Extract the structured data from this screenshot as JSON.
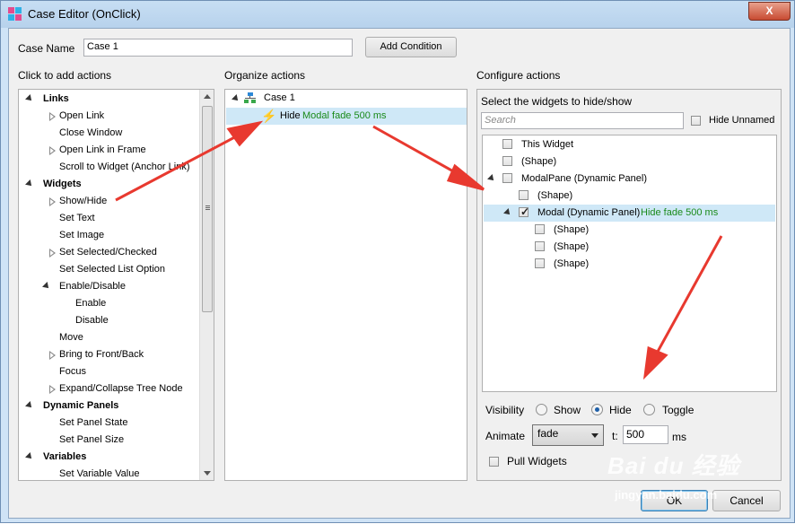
{
  "window": {
    "title": "Case Editor (OnClick)",
    "close_label": "X"
  },
  "case_name": {
    "label": "Case Name",
    "value": "Case 1",
    "add_condition_label": "Add Condition"
  },
  "left": {
    "header": "Click to add actions",
    "items": [
      {
        "label": "Links",
        "kind": "group"
      },
      {
        "label": "Open Link",
        "kind": "item-expand"
      },
      {
        "label": "Close Window",
        "kind": "item"
      },
      {
        "label": "Open Link in Frame",
        "kind": "item-expand"
      },
      {
        "label": "Scroll to Widget (Anchor Link)",
        "kind": "item"
      },
      {
        "label": "Widgets",
        "kind": "group"
      },
      {
        "label": "Show/Hide",
        "kind": "item-expand"
      },
      {
        "label": "Set Text",
        "kind": "item"
      },
      {
        "label": "Set Image",
        "kind": "item"
      },
      {
        "label": "Set Selected/Checked",
        "kind": "item-expand"
      },
      {
        "label": "Set Selected List Option",
        "kind": "item"
      },
      {
        "label": "Enable/Disable",
        "kind": "item-open"
      },
      {
        "label": "Enable",
        "kind": "sub"
      },
      {
        "label": "Disable",
        "kind": "sub"
      },
      {
        "label": "Move",
        "kind": "item"
      },
      {
        "label": "Bring to Front/Back",
        "kind": "item-expand"
      },
      {
        "label": "Focus",
        "kind": "item"
      },
      {
        "label": "Expand/Collapse Tree Node",
        "kind": "item-expand"
      },
      {
        "label": "Dynamic Panels",
        "kind": "group"
      },
      {
        "label": "Set Panel State",
        "kind": "item"
      },
      {
        "label": "Set Panel Size",
        "kind": "item"
      },
      {
        "label": "Variables",
        "kind": "group"
      },
      {
        "label": "Set Variable Value",
        "kind": "item"
      }
    ]
  },
  "middle": {
    "header": "Organize actions",
    "case_label": "Case 1",
    "action_verb": "Hide",
    "action_detail": "Modal fade 500 ms"
  },
  "right": {
    "header": "Configure actions",
    "select_label": "Select the widgets to hide/show",
    "search_placeholder": "Search",
    "hide_unnamed_label": "Hide Unnamed",
    "widgets": [
      {
        "label": "This Widget",
        "checked": false,
        "level": 0,
        "bold": false
      },
      {
        "label": "(Shape)",
        "checked": false,
        "level": 0,
        "bold": false
      },
      {
        "label": "ModalPane (Dynamic Panel)",
        "checked": false,
        "level": 0,
        "bold": false,
        "expander": true
      },
      {
        "label": "(Shape)",
        "checked": false,
        "level": 1,
        "bold": false
      },
      {
        "label": "Modal (Dynamic Panel)",
        "checked": true,
        "level": 1,
        "bold": false,
        "expander": true,
        "note": "Hide fade 500 ms"
      },
      {
        "label": "(Shape)",
        "checked": false,
        "level": 2,
        "bold": false
      },
      {
        "label": "(Shape)",
        "checked": false,
        "level": 2,
        "bold": false
      },
      {
        "label": "(Shape)",
        "checked": false,
        "level": 2,
        "bold": false
      }
    ],
    "visibility_label": "Visibility",
    "visibility_options": [
      "Show",
      "Hide",
      "Toggle"
    ],
    "visibility_selected": "Hide",
    "animate_label": "Animate",
    "animate_value": "fade",
    "t_label": "t:",
    "t_value": "500",
    "ms_label": "ms",
    "pull_widgets_label": "Pull Widgets"
  },
  "footer": {
    "ok_label": "OK",
    "cancel_label": "Cancel"
  },
  "colors": {
    "accent_arrow": "#e8392f",
    "selection": "#cfe8f7",
    "green_text": "#1a8a1a"
  },
  "watermark": {
    "brand": "Bai du 经验",
    "url": "jingyan.baidu.com"
  }
}
